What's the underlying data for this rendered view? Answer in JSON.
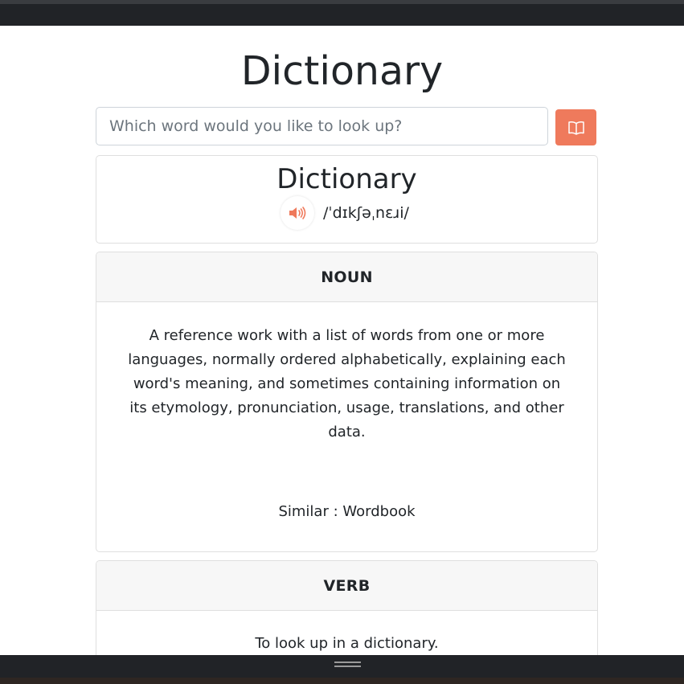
{
  "app": {
    "title": "Dictionary"
  },
  "search": {
    "placeholder": "Which word would you like to look up?",
    "value": "",
    "button_icon": "book-open-icon"
  },
  "word": {
    "text": "Dictionary",
    "phonetic": "/ˈdɪkʃəˌnɛɹi/",
    "audio_icon": "speaker-icon"
  },
  "meanings": [
    {
      "part_of_speech": "NOUN",
      "definition": "A reference work with a list of words from one or more languages, normally ordered alphabetically, explaining each word's meaning, and sometimes containing information on its etymology, pronunciation, usage, translations, and other data.",
      "similar_label": "Similar :",
      "similar_value": "Wordbook"
    },
    {
      "part_of_speech": "VERB",
      "definition": "To look up in a dictionary."
    }
  ],
  "colors": {
    "accent": "#ef7a5c",
    "text": "#212529",
    "card_header_bg": "#f7f7f7",
    "border": "#dfdfdf",
    "chrome_dark": "#212327"
  }
}
